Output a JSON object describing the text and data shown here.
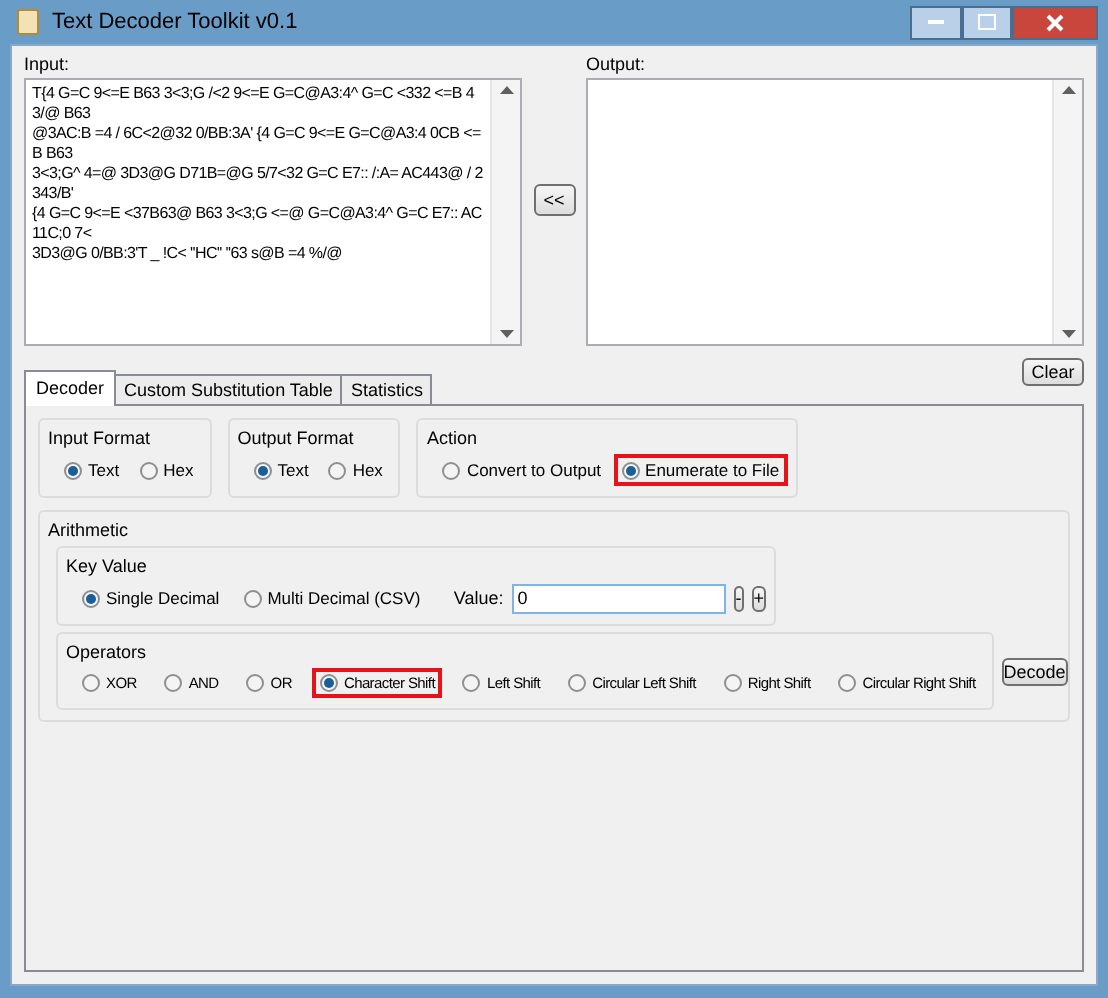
{
  "window": {
    "title": "Text Decoder Toolkit v0.1"
  },
  "input": {
    "label": "Input:",
    "lines": [
      "T{4 G=C 9<=E B63 3<3;G /<2 9<=E G=C@A3:4^ G=C <332 <=B 43/@ B63",
      "@3AC:B =4 / 6C<2@32 0/BB:3A' {4 G=C 9<=E G=C@A3:4 0CB <=B B63",
      "3<3;G^ 4=@ 3D3@G D71B=@G 5/7<32 G=C E7:: /:A= AC443@ / 2343/B'",
      "{4 G=C 9<=E <37B63@ B63 3<3;G <=@ G=C@A3:4^ G=C E7:: AC11C;0 7<",
      "3D3@G 0/BB:3'T _ !C< ''HC'' ''63 s@B =4 %/@"
    ]
  },
  "swap_button": "<<",
  "output": {
    "label": "Output:"
  },
  "clear_button": "Clear",
  "tabs": [
    {
      "label": "Decoder",
      "selected": true
    },
    {
      "label": "Custom Substitution Table",
      "selected": false
    },
    {
      "label": "Statistics",
      "selected": false
    }
  ],
  "groups": [
    {
      "title": "Input Format",
      "options": [
        {
          "label": "Text",
          "selected": true,
          "highlighted": false
        },
        {
          "label": "Hex",
          "selected": false,
          "highlighted": false
        }
      ]
    },
    {
      "title": "Output Format",
      "options": [
        {
          "label": "Text",
          "selected": true,
          "highlighted": false
        },
        {
          "label": "Hex",
          "selected": false,
          "highlighted": false
        }
      ]
    },
    {
      "title": "Action",
      "options": [
        {
          "label": "Convert to Output",
          "selected": false,
          "highlighted": false
        },
        {
          "label": "Enumerate to File",
          "selected": true,
          "highlighted": true
        }
      ]
    }
  ],
  "arithmetic": {
    "title": "Arithmetic",
    "key_value": {
      "title": "Key Value",
      "options": [
        {
          "label": "Single Decimal",
          "selected": true,
          "highlighted": false
        },
        {
          "label": "Multi Decimal (CSV)",
          "selected": false,
          "highlighted": false
        }
      ],
      "value_label": "Value:",
      "value": "0",
      "minus": "-",
      "plus": "+"
    },
    "operators": {
      "title": "Operators",
      "options": [
        {
          "label": "XOR",
          "selected": false,
          "highlighted": false
        },
        {
          "label": "AND",
          "selected": false,
          "highlighted": false
        },
        {
          "label": "OR",
          "selected": false,
          "highlighted": false
        },
        {
          "label": "Character Shift",
          "selected": true,
          "highlighted": true
        },
        {
          "label": "Left Shift",
          "selected": false,
          "highlighted": false
        },
        {
          "label": "Circular Left Shift",
          "selected": false,
          "highlighted": false
        },
        {
          "label": "Right Shift",
          "selected": false,
          "highlighted": false
        },
        {
          "label": "Circular Right Shift",
          "selected": false,
          "highlighted": false
        }
      ]
    },
    "decode_button": "Decode"
  }
}
